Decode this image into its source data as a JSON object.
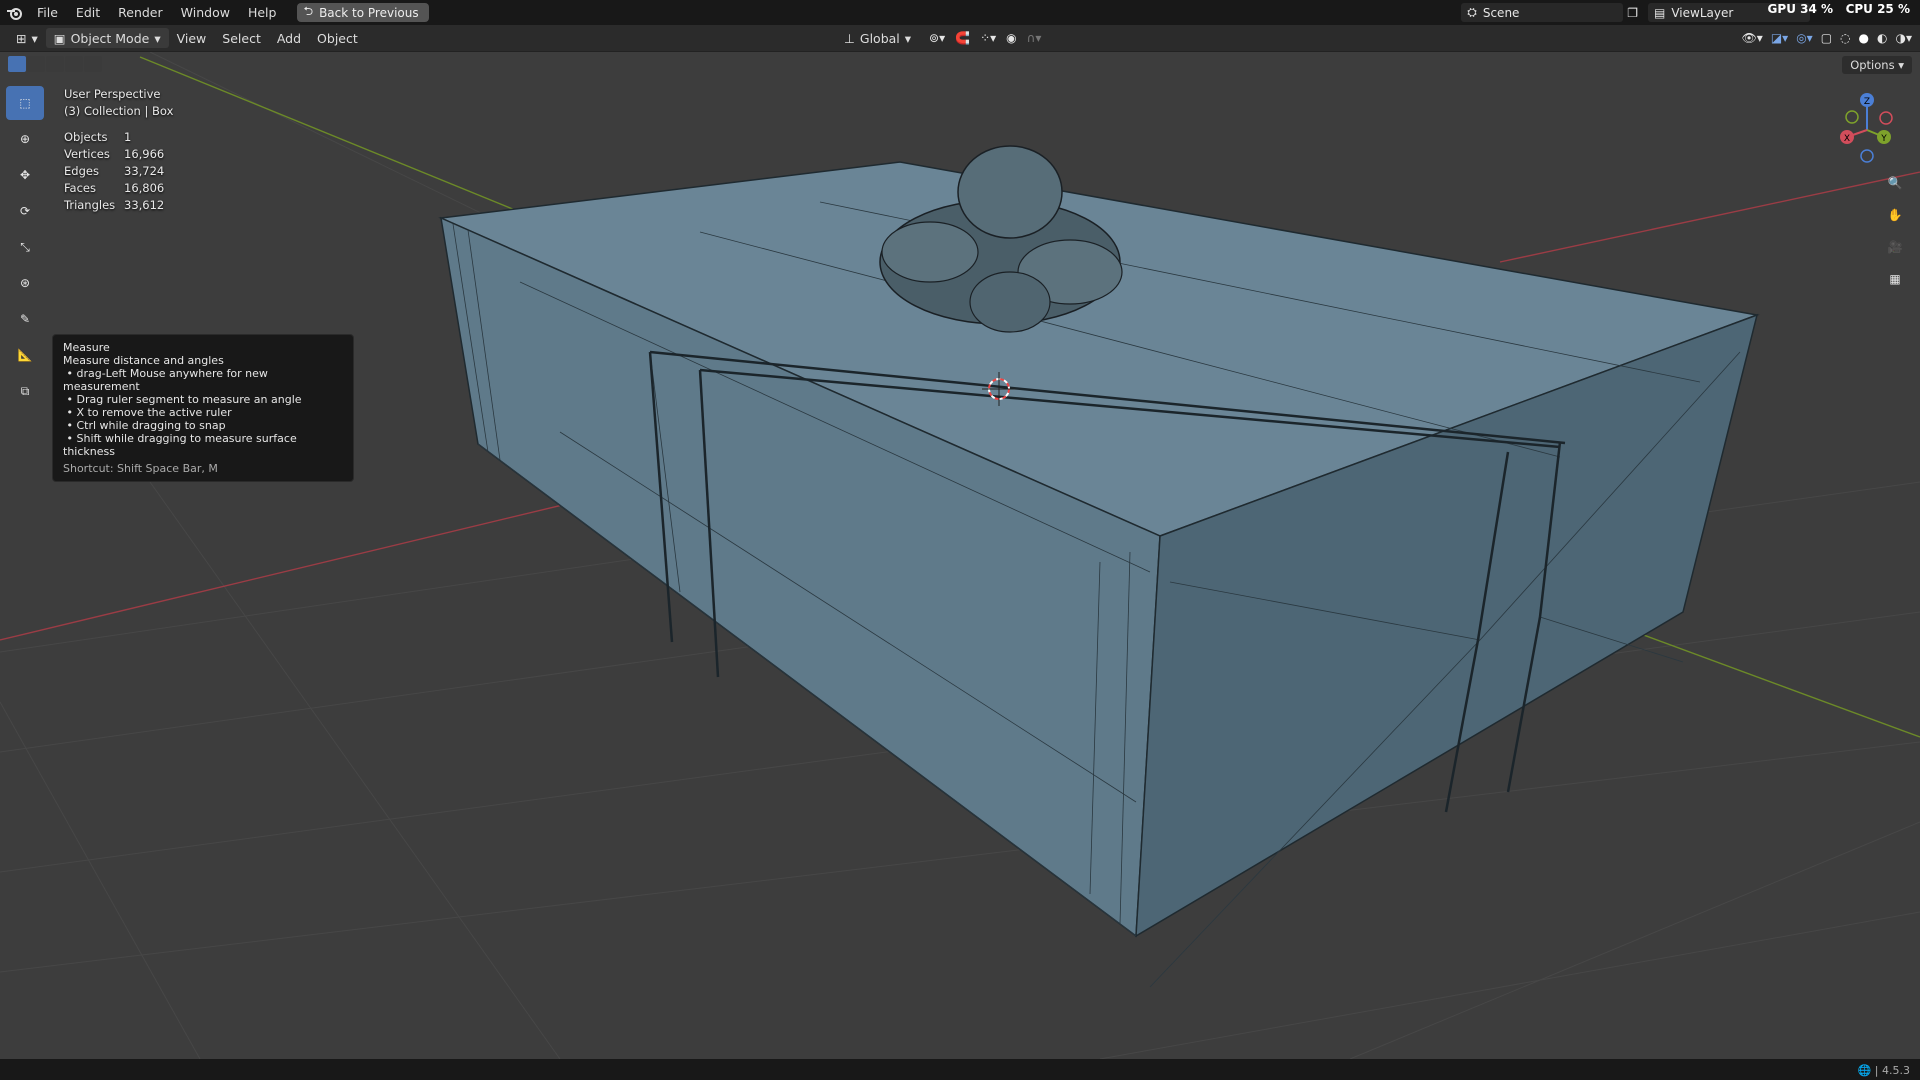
{
  "menu": [
    "File",
    "Edit",
    "Render",
    "Window",
    "Help"
  ],
  "back_button": "Back to Previous",
  "scene": {
    "label": "Scene"
  },
  "view_layer": {
    "label": "ViewLayer"
  },
  "usage": {
    "gpu": "GPU 34 %",
    "cpu": "CPU 25 %"
  },
  "header": {
    "mode": "Object Mode",
    "menus": [
      "View",
      "Select",
      "Add",
      "Object"
    ],
    "orientation": "Global",
    "options": "Options"
  },
  "viewport": {
    "title": "User Perspective",
    "collection": "(3) Collection | Box"
  },
  "stats": [
    {
      "k": "Objects",
      "v": "1"
    },
    {
      "k": "Vertices",
      "v": "16,966"
    },
    {
      "k": "Edges",
      "v": "33,724"
    },
    {
      "k": "Faces",
      "v": "16,806"
    },
    {
      "k": "Triangles",
      "v": "33,612"
    }
  ],
  "tooltip": {
    "title": "Measure",
    "desc": "Measure distance and angles",
    "items": [
      "drag-Left Mouse anywhere for new measurement",
      "Drag ruler segment to measure an angle",
      "X to remove the active ruler",
      "Ctrl while dragging to snap",
      "Shift while dragging to measure surface thickness"
    ],
    "shortcut": "Shortcut: Shift Space Bar, M"
  },
  "gizmo": {
    "x": "X",
    "y": "Y",
    "z": "Z"
  },
  "version": "4.5.3",
  "colors": {
    "accent": "#4772b3",
    "box": "#6b8797",
    "x_axis": "#b5444f",
    "y_axis": "#7c9b2a"
  }
}
